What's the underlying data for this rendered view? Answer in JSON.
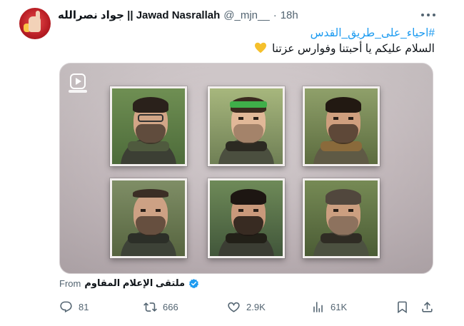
{
  "author": {
    "display_name": "جواد نصرالله || Jawad Nasrallah",
    "handle": "@_mjn__",
    "separator": "·",
    "time": "18h"
  },
  "tweet": {
    "hashtag": "#احياء_على_طريق_القدس",
    "text": "السلام عليكم يا أحبتنا وفوارس عزتنا"
  },
  "media": {
    "type": "video"
  },
  "source": {
    "prefix": "From",
    "name": "ملتقى الإعلام المقاوم"
  },
  "actions": {
    "replies": "81",
    "reposts": "666",
    "likes": "2.9K",
    "views": "61K"
  },
  "colors": {
    "accent": "#1d9bf0",
    "text": "#0f1419",
    "muted": "#536471",
    "heart_emoji": "#f5c02c"
  }
}
